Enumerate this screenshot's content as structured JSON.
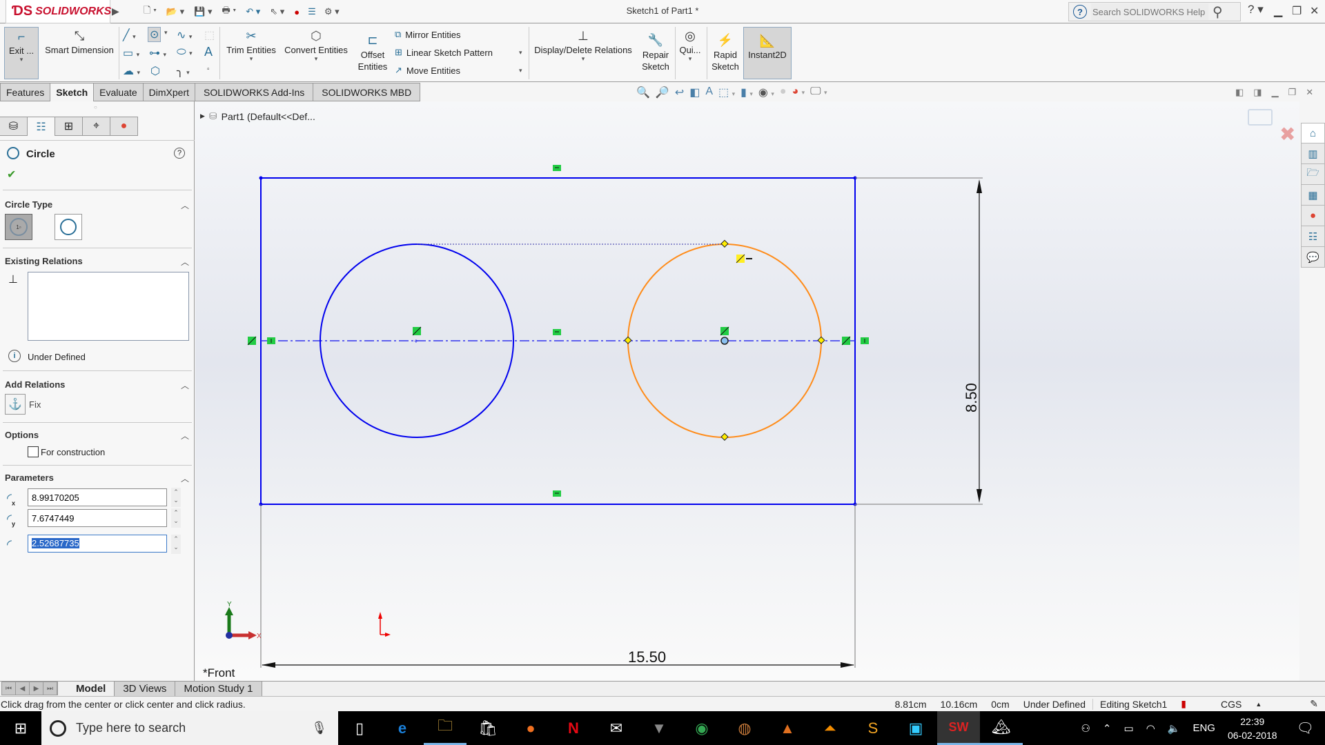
{
  "app": {
    "brand": "SOLIDWORKS",
    "brand_prefix": "DS",
    "doc_title": "Sketch1 of Part1 *",
    "search_placeholder": "Search SOLIDWORKS Help",
    "help_label": "?",
    "window_controls": [
      "minimize",
      "restore",
      "close"
    ]
  },
  "quick_access": [
    "new-document",
    "open",
    "save",
    "print",
    "undo",
    "select",
    "rebuild",
    "file-properties",
    "options"
  ],
  "ribbon": {
    "exit_sketch": "Exit ...",
    "smart_dimension": "Smart Dimension",
    "trim_entities": "Trim Entities",
    "convert_entities": "Convert Entities",
    "offset_entities_1": "Offset",
    "offset_entities_2": "Entities",
    "mirror_entities": "Mirror Entities",
    "linear_sketch_pattern": "Linear Sketch Pattern",
    "move_entities": "Move Entities",
    "display_delete_relations": "Display/Delete Relations",
    "repair_sketch_1": "Repair",
    "repair_sketch_2": "Sketch",
    "quick_snaps": "Qui...",
    "rapid_sketch_1": "Rapid",
    "rapid_sketch_2": "Sketch",
    "instant2d": "Instant2D"
  },
  "command_tabs": [
    {
      "label": "Features",
      "active": false
    },
    {
      "label": "Sketch",
      "active": true
    },
    {
      "label": "Evaluate",
      "active": false
    },
    {
      "label": "DimXpert",
      "active": false
    },
    {
      "label": "SOLIDWORKS Add-Ins",
      "active": false
    },
    {
      "label": "SOLIDWORKS MBD",
      "active": false
    }
  ],
  "panel": {
    "title": "Circle",
    "confirm": "✔",
    "circle_type": {
      "title": "Circle Type",
      "options": [
        "Center-point circle",
        "Perimeter circle"
      ],
      "selected": 0
    },
    "existing_relations": {
      "title": "Existing Relations",
      "items": [],
      "status": "Under Defined"
    },
    "add_relations": {
      "title": "Add Relations",
      "items": [
        "Fix"
      ]
    },
    "options": {
      "title": "Options",
      "for_construction_label": "For construction",
      "for_construction": false
    },
    "parameters": {
      "title": "Parameters",
      "center_x": "8.99170205",
      "center_y": "7.6747449",
      "radius": "2.52687735"
    }
  },
  "feature_tree": {
    "root": "Part1  (Default<<Def..."
  },
  "sketch": {
    "rectangle": {
      "width_dim": "15.50",
      "height_dim": "8.50"
    },
    "circles": [
      {
        "name": "left-circle",
        "state": "defined",
        "color": "#0000ee"
      },
      {
        "name": "right-circle",
        "state": "active",
        "color": "#ff8c1a"
      }
    ],
    "line_color": "#0000ee",
    "dim_color": "#000000"
  },
  "view_label": "*Front",
  "bottom_tabs": [
    {
      "label": "Model",
      "active": true
    },
    {
      "label": "3D Views",
      "active": false
    },
    {
      "label": "Motion Study 1",
      "active": false
    }
  ],
  "status": {
    "message": "Click drag from the center or click center and click radius.",
    "x": "8.81cm",
    "y": "10.16cm",
    "z": "0cm",
    "definition": "Under Defined",
    "editing": "Editing Sketch1",
    "units": "CGS"
  },
  "taskbar": {
    "search_placeholder": "Type here to search",
    "apps": [
      "task-view",
      "edge",
      "file-explorer",
      "store",
      "firefox",
      "netflix",
      "mail",
      "predator",
      "chrome",
      "app-circle",
      "matlab",
      "vlc",
      "sublime",
      "circuit-app",
      "solidworks-2016",
      "photos"
    ],
    "language": "ENG",
    "time": "22:39",
    "date": "06-02-2018"
  }
}
